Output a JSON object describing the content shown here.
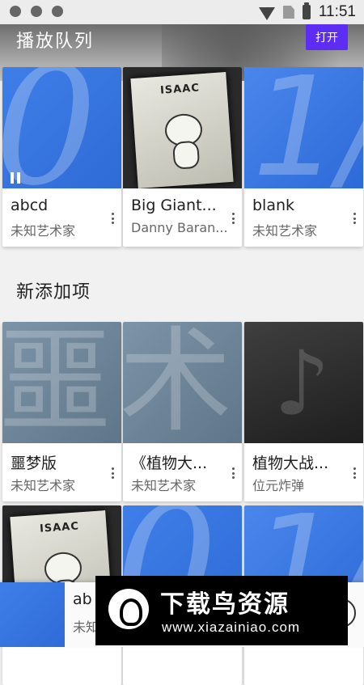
{
  "status_bar": {
    "time": "11:51",
    "left_icons": [
      "shield-icon",
      "bug-icon",
      "shield-icon"
    ],
    "right_icons": [
      "wifi-icon",
      "no-sim-icon",
      "battery-charging-icon"
    ]
  },
  "queue": {
    "title": "播放队列",
    "open_label": "打开",
    "items": [
      {
        "title": "abcd",
        "subtitle": "未知艺术家",
        "art": "blue-glyph",
        "playing": true
      },
      {
        "title": "Big Giant...",
        "subtitle": "Danny Baran...",
        "art": "isaac-cover"
      },
      {
        "title": "blank",
        "subtitle": "未知艺术家",
        "art": "blue-glyph"
      }
    ]
  },
  "recent": {
    "title": "新添加项",
    "items": [
      {
        "title": "噩梦版",
        "subtitle": "未知艺术家",
        "art": "slate-glyph"
      },
      {
        "title": "《植物大...",
        "subtitle": "未知艺术家",
        "art": "slate-glyph"
      },
      {
        "title": "植物大战...",
        "subtitle": "位元炸弹",
        "art": "music-note-glyph"
      }
    ]
  },
  "now_playing": {
    "title": "ab",
    "subtitle": "未知",
    "art": "blue-glyph"
  },
  "watermark": {
    "title": "下载鸟资源",
    "url": "www.xiazainiao.com"
  },
  "isaac_cover_text": "ISAAC",
  "colors": {
    "accent": "#5e2df3",
    "blue_art": "#3f7ee8",
    "slate_art": "#6f8699"
  }
}
